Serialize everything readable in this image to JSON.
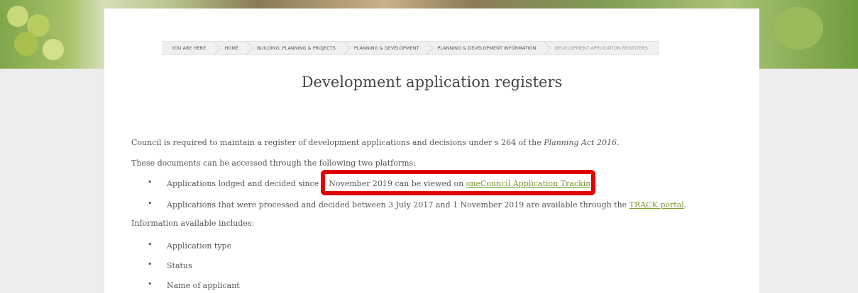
{
  "breadcrumb": [
    "YOU ARE HERE",
    "HOME",
    "BUILDING, PLANNING & PROJECTS",
    "PLANNING & DEVELOPMENT",
    "PLANNING & DEVELOPMENT INFORMATION",
    "DEVELOPMENT APPLICATION REGISTERS"
  ],
  "page_title": "Development application registers",
  "intro_text": "Council is required to maintain a register of development applications and decisions under s 264 of the ",
  "intro_italic": "Planning Act 2016",
  "intro_end": ".",
  "platforms_text": "These documents can be accessed through the following two platforms:",
  "bullets": {
    "b1_pre": "Applications lodged and decided since 1 November 2019 can be viewed on ",
    "b1_link": "oneCouncil Application Tracking",
    "b1_post": ".",
    "b2_pre": "Applications that were processed and decided between 3 July 2017 and 1 November 2019 are available through the ",
    "b2_link": "TRACK portal",
    "b2_post": "."
  },
  "info_text": "Information available includes:",
  "info_items": [
    "Application type",
    "Status",
    "Name of applicant"
  ],
  "colors": {
    "link": "#7a9a2c",
    "highlight": "#e00000"
  }
}
